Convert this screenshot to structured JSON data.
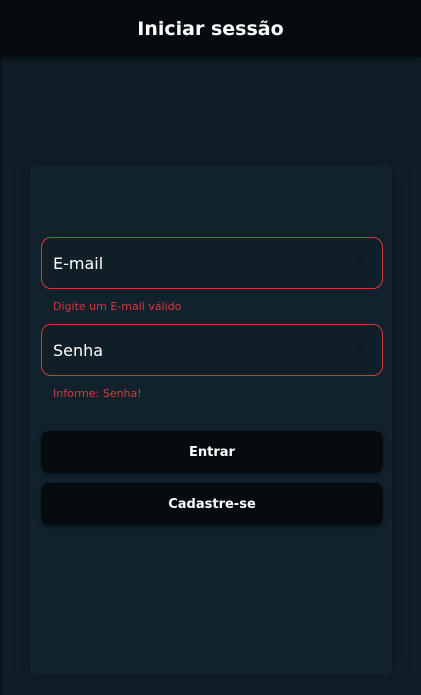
{
  "header": {
    "title": "Iniciar sessão"
  },
  "form": {
    "email": {
      "placeholder": "E-mail",
      "value": "",
      "error": "Digite um E-mail válido"
    },
    "senha": {
      "placeholder": "Senha",
      "value": "",
      "error": "Informe: Senha!"
    },
    "clear_icon": "×",
    "login_label": "Entrar",
    "signup_label": "Cadastre-se"
  },
  "colors": {
    "background": "#0f1e27",
    "header": "#050b0e",
    "error": "#d1393f",
    "button": "#050b0e"
  }
}
